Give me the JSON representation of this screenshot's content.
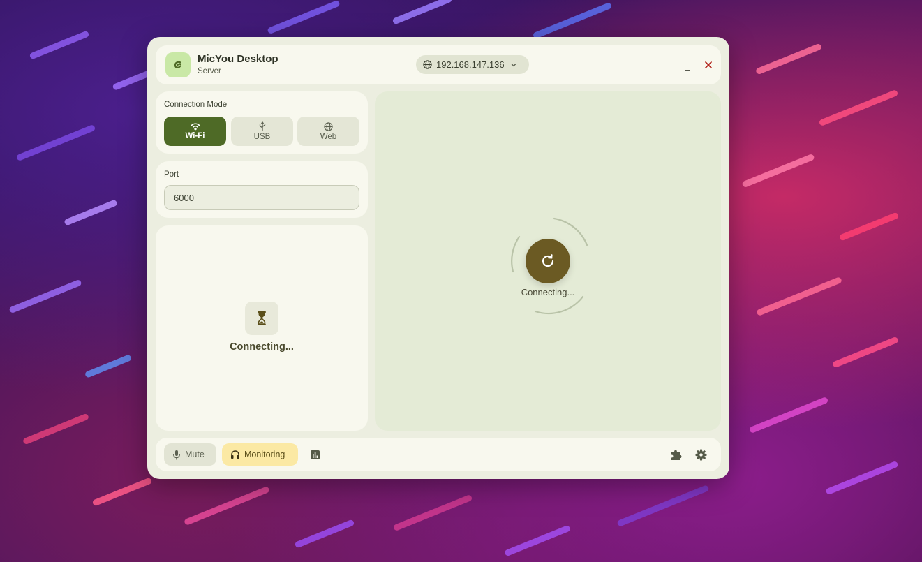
{
  "app": {
    "title": "MicYou Desktop",
    "subtitle": "Server"
  },
  "header": {
    "ip_address": "192.168.147.136"
  },
  "connection_mode": {
    "label": "Connection Mode",
    "options": [
      {
        "label": "Wi-Fi",
        "icon": "wifi-icon",
        "selected": true
      },
      {
        "label": "USB",
        "icon": "usb-icon",
        "selected": false
      },
      {
        "label": "Web",
        "icon": "globe-icon",
        "selected": false
      }
    ]
  },
  "port": {
    "label": "Port",
    "value": "6000"
  },
  "status_card": {
    "text": "Connecting...",
    "icon": "hourglass-icon"
  },
  "main_panel": {
    "status": "Connecting...",
    "icon": "refresh-icon"
  },
  "bottom_bar": {
    "mute_label": "Mute",
    "monitoring_label": "Monitoring",
    "icons": [
      "bar-chart-icon",
      "puzzle-icon",
      "gear-icon"
    ]
  },
  "colors": {
    "accent": "#4e6a26",
    "window_bg": "#eceee0",
    "panel_bg": "#e4ebd6",
    "refresh_button": "#6b5a23",
    "monitoring_bg": "#fbe9a4",
    "close_icon": "#b3261e"
  }
}
